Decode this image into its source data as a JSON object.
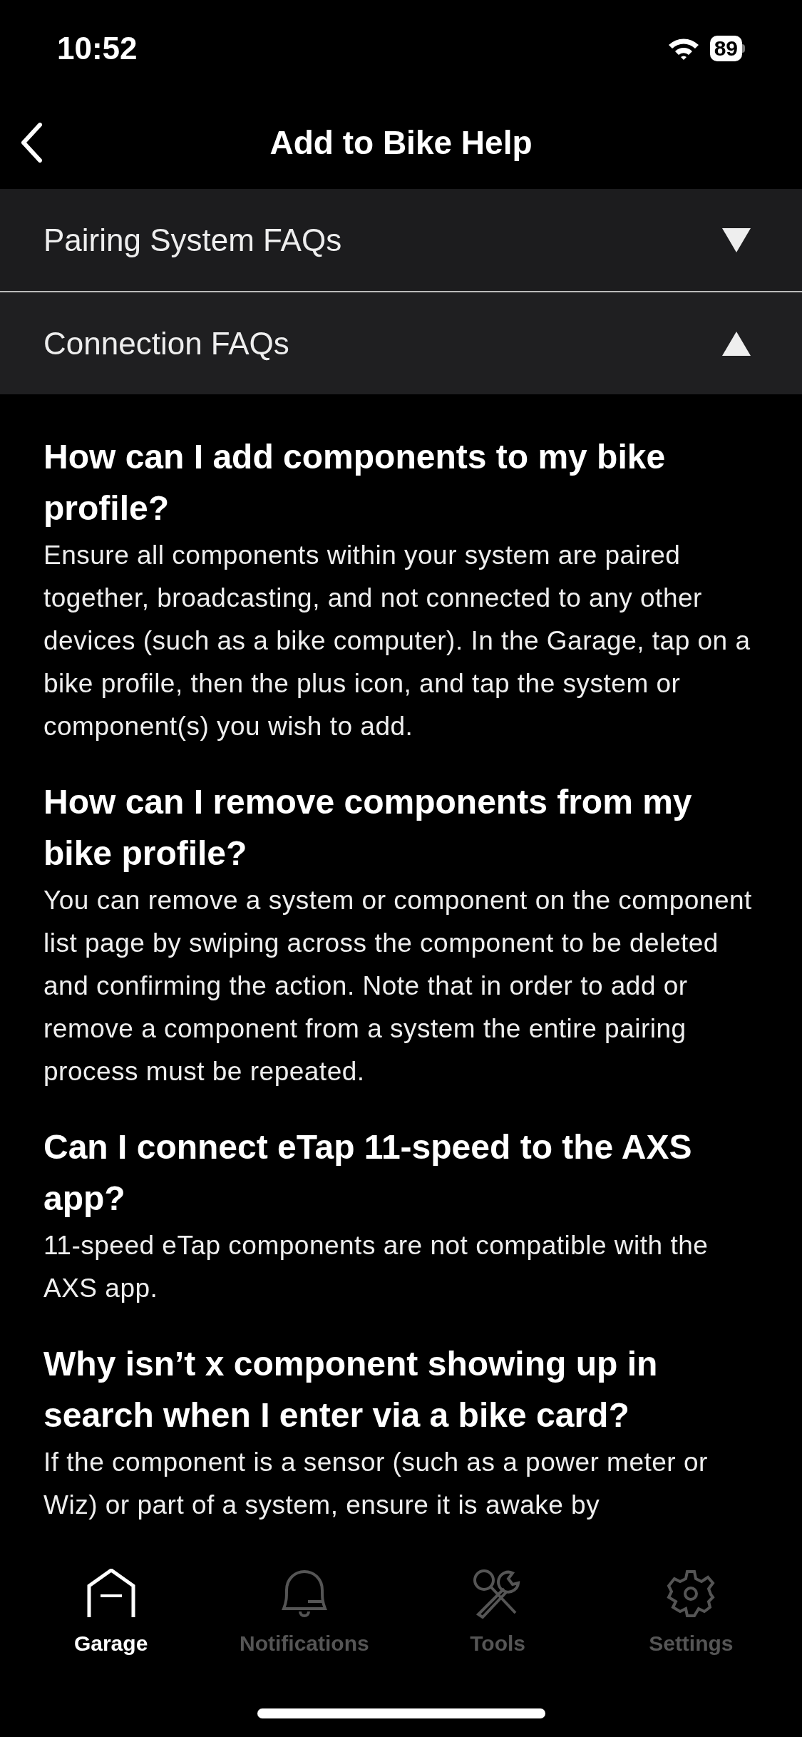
{
  "status_bar": {
    "time": "10:52",
    "battery": "89"
  },
  "nav": {
    "title": "Add to Bike Help"
  },
  "sections": [
    {
      "title": "Pairing System FAQs",
      "expanded": false
    },
    {
      "title": "Connection FAQs",
      "expanded": true,
      "faqs": [
        {
          "question": "How can I add components to my bike profile?",
          "answer": "Ensure all components within your system are paired together, broadcasting, and not connected to any other devices (such as a bike computer). In the Garage, tap on a bike profile, then the plus icon, and tap the system or component(s) you wish to add."
        },
        {
          "question": "How can I remove components from my bike profile?",
          "answer": "You can remove a system or component on the component list page by swiping across the component to be deleted and confirming the action. Note that in order to add or remove a component from a system the entire pairing process must be repeated."
        },
        {
          "question": "Can I connect eTap 11-speed to the AXS app?",
          "answer": "11-speed eTap components are not compatible with the AXS app."
        },
        {
          "question": "Why isn’t x component showing up in search when I enter via a bike card?",
          "answer": "If the component is a sensor (such as a power meter or Wiz) or part of a system, ensure it is awake by"
        }
      ]
    }
  ],
  "tab_bar": [
    {
      "label": "Garage",
      "kind": "garage",
      "selected": true
    },
    {
      "label": "Notifications",
      "kind": "bell",
      "selected": false
    },
    {
      "label": "Tools",
      "kind": "tools",
      "selected": false
    },
    {
      "label": "Settings",
      "kind": "gear",
      "selected": false
    }
  ]
}
